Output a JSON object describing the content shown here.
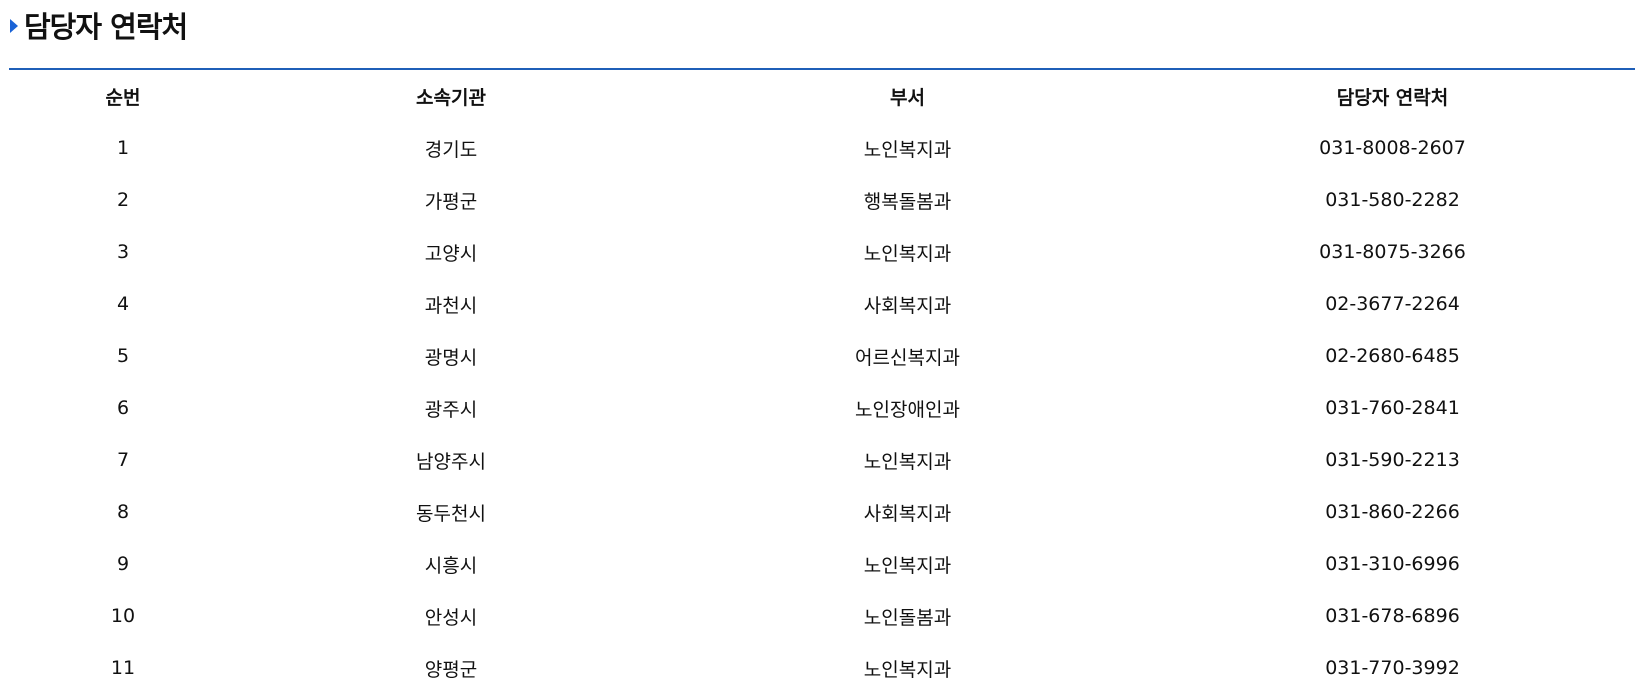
{
  "section": {
    "title": "담당자 연락처"
  },
  "table": {
    "headers": [
      "순번",
      "소속기관",
      "부서",
      "담당자 연락처"
    ],
    "rows": [
      [
        "1",
        "경기도",
        "노인복지과",
        "031-8008-2607"
      ],
      [
        "2",
        "가평군",
        "행복돌봄과",
        "031-580-2282"
      ],
      [
        "3",
        "고양시",
        "노인복지과",
        "031-8075-3266"
      ],
      [
        "4",
        "과천시",
        "사회복지과",
        "02-3677-2264"
      ],
      [
        "5",
        "광명시",
        "어르신복지과",
        "02-2680-6485"
      ],
      [
        "6",
        "광주시",
        "노인장애인과",
        "031-760-2841"
      ],
      [
        "7",
        "남양주시",
        "노인복지과",
        "031-590-2213"
      ],
      [
        "8",
        "동두천시",
        "사회복지과",
        "031-860-2266"
      ],
      [
        "9",
        "시흥시",
        "노인복지과",
        "031-310-6996"
      ],
      [
        "10",
        "안성시",
        "노인돌봄과",
        "031-678-6896"
      ],
      [
        "11",
        "양평군",
        "노인복지과",
        "031-770-3992"
      ]
    ]
  },
  "colors": {
    "accent": "#1a63d6",
    "rule": "#1f5fb8",
    "text": "#111111"
  }
}
